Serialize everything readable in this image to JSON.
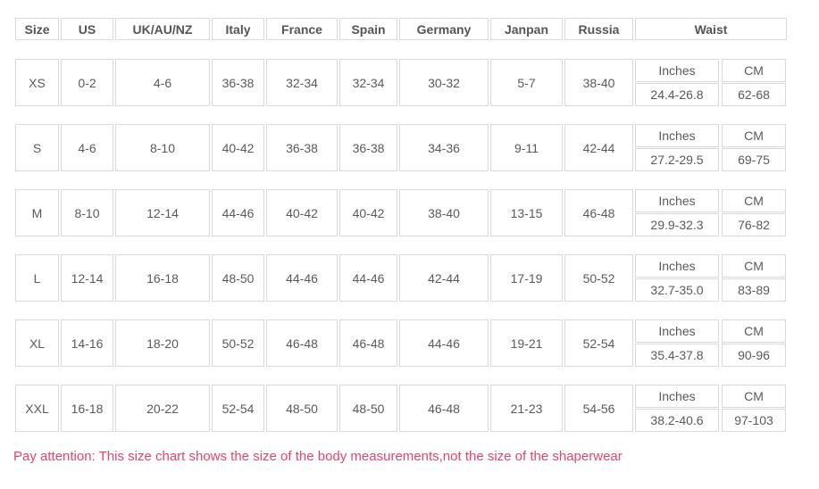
{
  "table": {
    "headers": [
      "Size",
      "US",
      "UK/AU/NZ",
      "Italy",
      "France",
      "Spain",
      "Germany",
      "Janpan",
      "Russia",
      "Waist"
    ],
    "waist_sub": {
      "inches": "Inches",
      "cm": "CM"
    },
    "rows": [
      {
        "size": "XS",
        "us": "0-2",
        "uk": "4-6",
        "italy": "36-38",
        "france": "32-34",
        "spain": "32-34",
        "germany": "30-32",
        "japan": "5-7",
        "russia": "38-40",
        "inches": "24.4-26.8",
        "cm": "62-68"
      },
      {
        "size": "S",
        "us": "4-6",
        "uk": "8-10",
        "italy": "40-42",
        "france": "36-38",
        "spain": "36-38",
        "germany": "34-36",
        "japan": "9-11",
        "russia": "42-44",
        "inches": "27.2-29.5",
        "cm": "69-75"
      },
      {
        "size": "M",
        "us": "8-10",
        "uk": "12-14",
        "italy": "44-46",
        "france": "40-42",
        "spain": "40-42",
        "germany": "38-40",
        "japan": "13-15",
        "russia": "46-48",
        "inches": "29.9-32.3",
        "cm": "76-82"
      },
      {
        "size": "L",
        "us": "12-14",
        "uk": "16-18",
        "italy": "48-50",
        "france": "44-46",
        "spain": "44-46",
        "germany": "42-44",
        "japan": "17-19",
        "russia": "50-52",
        "inches": "32.7-35.0",
        "cm": "83-89"
      },
      {
        "size": "XL",
        "us": "14-16",
        "uk": "18-20",
        "italy": "50-52",
        "france": "46-48",
        "spain": "46-48",
        "germany": "44-46",
        "japan": "19-21",
        "russia": "52-54",
        "inches": "35.4-37.8",
        "cm": "90-96"
      },
      {
        "size": "XXL",
        "us": "16-18",
        "uk": "20-22",
        "italy": "52-54",
        "france": "48-50",
        "spain": "48-50",
        "germany": "46-48",
        "japan": "21-23",
        "russia": "54-56",
        "inches": "38.2-40.6",
        "cm": "97-103"
      }
    ]
  },
  "note": "Pay attention: This size chart shows the size of the body measurements,not the size of the shaperwear",
  "colors": {
    "note": "#e2466e",
    "border": "#d9d9d9",
    "text": "#5a5a5a"
  }
}
